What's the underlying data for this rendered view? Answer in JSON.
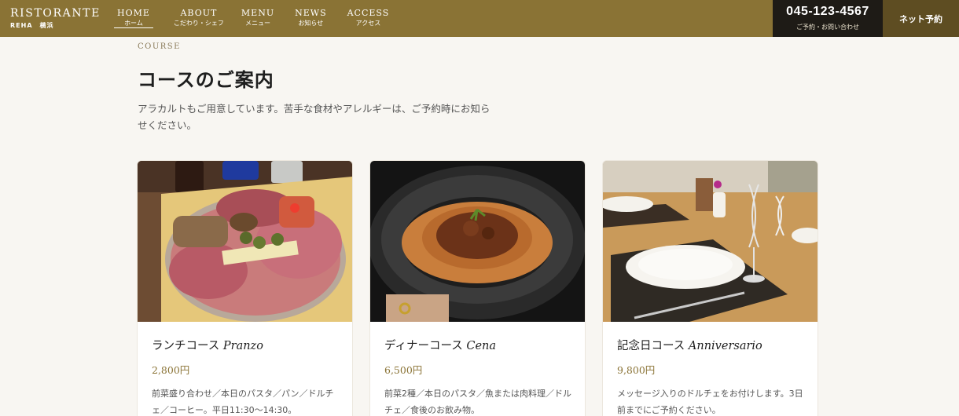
{
  "brand": {
    "name": "RISTORANTE",
    "sub": "REHA　横浜"
  },
  "nav": [
    {
      "en": "HOME",
      "ja": "ホーム"
    },
    {
      "en": "ABOUT",
      "ja": "こだわり・シェフ"
    },
    {
      "en": "MENU",
      "ja": "メニュー"
    },
    {
      "en": "NEWS",
      "ja": "お知らせ"
    },
    {
      "en": "ACCESS",
      "ja": "アクセス"
    }
  ],
  "contact": {
    "phone": "045-123-4567",
    "label": "ご予約・お問い合わせ"
  },
  "reserve_label": "ネット予約",
  "section": {
    "eyebrow": "COURSE",
    "title": "コースのご案内",
    "lead": "アラカルトもご用意しています。苦手な食材やアレルギーは、ご予約時にお知らせください。"
  },
  "courses": [
    {
      "name_ja": "ランチコース",
      "name_it": "Pranzo",
      "price": "2,800円",
      "desc": "前菜盛り合わせ／本日のパスタ／パン／ドルチェ／コーヒー。平日11:30〜14:30。"
    },
    {
      "name_ja": "ディナーコース",
      "name_it": "Cena",
      "price": "6,500円",
      "desc": "前菜2種／本日のパスタ／魚または肉料理／ドルチェ／食後のお飲み物。"
    },
    {
      "name_ja": "記念日コース",
      "name_it": "Anniversario",
      "price": "9,800円",
      "desc": "メッセージ入りのドルチェをお付けします。3日前までにご予約ください。"
    }
  ],
  "colors": {
    "header": "#8a7335",
    "phone_bg": "#1e1b16",
    "reserve_bg": "#5e4d22",
    "accent": "#8a7335",
    "page_bg": "#f8f6f2"
  }
}
